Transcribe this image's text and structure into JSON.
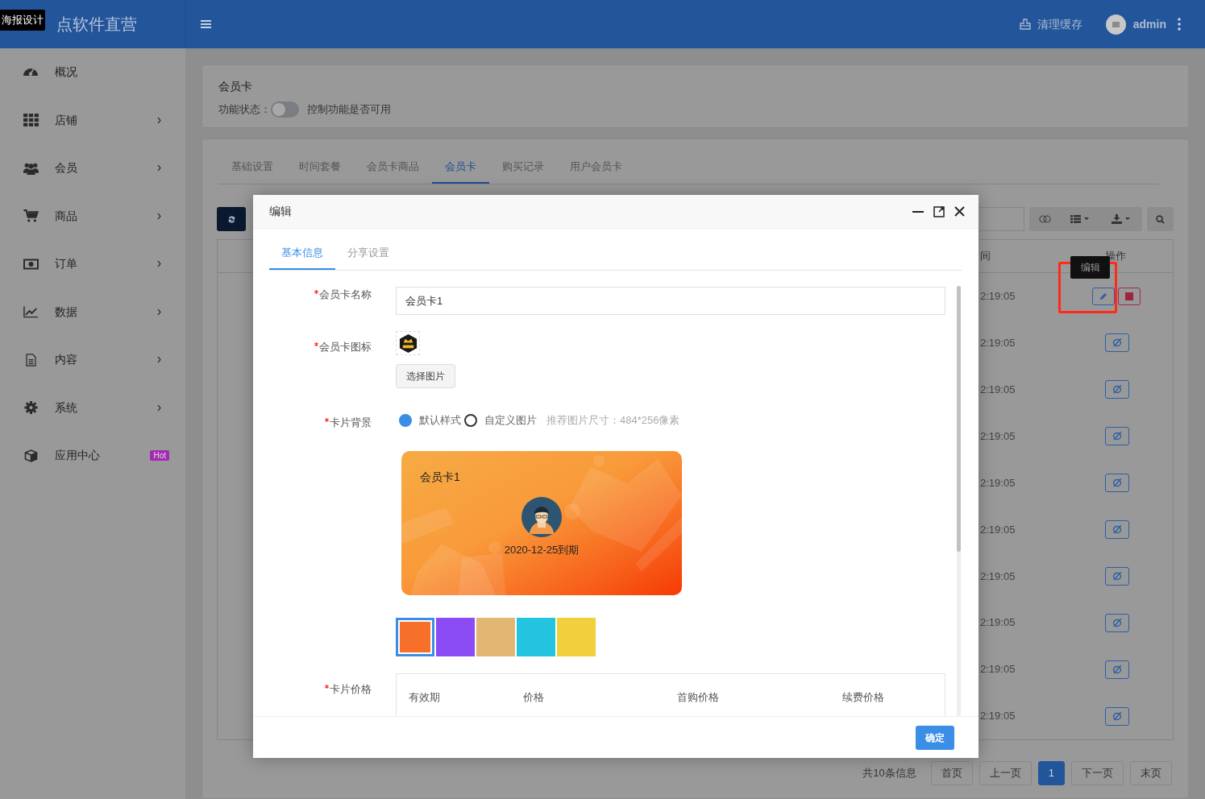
{
  "header": {
    "logo_tooltip": "海报设计",
    "brand": "点软件直营",
    "clear_cache": "清理缓存",
    "user": "admin"
  },
  "sidebar": {
    "items": [
      {
        "label": "概况",
        "has_children": false
      },
      {
        "label": "店铺",
        "has_children": true
      },
      {
        "label": "会员",
        "has_children": true
      },
      {
        "label": "商品",
        "has_children": true
      },
      {
        "label": "订单",
        "has_children": true
      },
      {
        "label": "数据",
        "has_children": true
      },
      {
        "label": "内容",
        "has_children": true
      },
      {
        "label": "系统",
        "has_children": true
      },
      {
        "label": "应用中心",
        "has_children": false,
        "badge": "Hot"
      }
    ]
  },
  "feature": {
    "title": "会员卡",
    "status_label": "功能状态：",
    "on": false,
    "hint": "控制功能是否可用"
  },
  "tabs": [
    {
      "label": "基础设置",
      "selected": false
    },
    {
      "label": "时间套餐",
      "selected": false
    },
    {
      "label": "会员卡商品",
      "selected": false
    },
    {
      "label": "会员卡",
      "selected": true
    },
    {
      "label": "购买记录",
      "selected": false
    },
    {
      "label": "用户会员卡",
      "selected": false
    }
  ],
  "table": {
    "columns": [
      "间",
      "操作"
    ],
    "tooltip": "编辑",
    "rows": [
      {
        "time": "2:19:05",
        "kind": "edit_delete"
      },
      {
        "time": "2:19:05",
        "kind": "toggle"
      },
      {
        "time": "2:19:05",
        "kind": "toggle"
      },
      {
        "time": "2:19:05",
        "kind": "toggle"
      },
      {
        "time": "2:19:05",
        "kind": "toggle"
      },
      {
        "time": "2:19:05",
        "kind": "toggle"
      },
      {
        "time": "2:19:05",
        "kind": "toggle"
      },
      {
        "time": "2:19:05",
        "kind": "toggle"
      },
      {
        "time": "2:19:05",
        "kind": "toggle"
      },
      {
        "time": "2:19:05",
        "kind": "toggle"
      }
    ]
  },
  "pagination": {
    "summary": "共10条信息",
    "buttons": [
      {
        "label": "首页",
        "selected": false
      },
      {
        "label": "上一页",
        "selected": false
      },
      {
        "label": "1",
        "selected": true
      },
      {
        "label": "下一页",
        "selected": false
      },
      {
        "label": "末页",
        "selected": false
      }
    ]
  },
  "modal": {
    "title": "编辑",
    "tabs": [
      {
        "label": "基本信息",
        "selected": true
      },
      {
        "label": "分享设置",
        "selected": false
      }
    ],
    "name_field": {
      "label": "会员卡名称",
      "required": true,
      "value": "会员卡1"
    },
    "icon_field": {
      "label": "会员卡图标",
      "required": true,
      "button": "选择图片"
    },
    "background_field": {
      "label": "卡片背景",
      "required": true,
      "options": [
        {
          "label": "默认样式",
          "selected": true
        },
        {
          "label": "自定义图片",
          "selected": false
        }
      ],
      "hint": "推荐图片尺寸：484*256像素"
    },
    "card_preview": {
      "name": "会员卡1",
      "expiry": "2020-12-25到期"
    },
    "swatches": [
      {
        "color": "#f7702a",
        "selected": true
      },
      {
        "color": "#8b4cf5",
        "selected": false
      },
      {
        "color": "#e2b774",
        "selected": false
      },
      {
        "color": "#22c4e0",
        "selected": false
      },
      {
        "color": "#f2cf3d",
        "selected": false
      }
    ],
    "price_field": {
      "label": "卡片价格",
      "required": true,
      "columns": [
        "有效期",
        "价格",
        "首购价格",
        "续费价格"
      ]
    },
    "submit": "确定"
  }
}
